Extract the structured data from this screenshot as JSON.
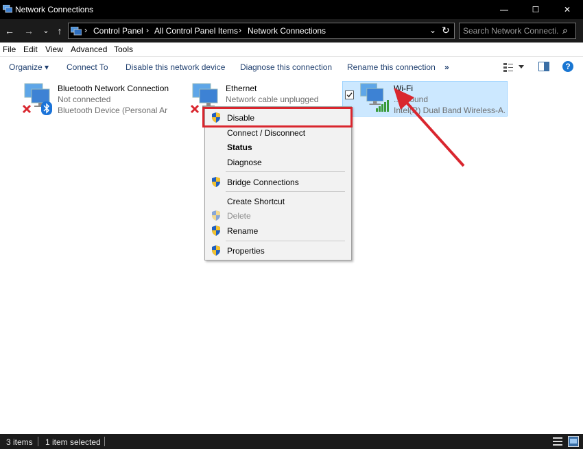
{
  "window": {
    "title": "Network Connections",
    "minimize_glyph": "—",
    "maximize_glyph": "☐",
    "close_glyph": "✕"
  },
  "address": {
    "back_glyph": "←",
    "forward_glyph": "→",
    "recent_glyph": "⌄",
    "up_glyph": "↑",
    "breadcrumb": [
      "Control Panel",
      "All Control Panel Items",
      "Network Connections"
    ],
    "separator": "›",
    "dropdown_glyph": "⌄",
    "refresh_glyph": "↻",
    "search_placeholder": "Search Network Connecti...",
    "search_glyph": "⌕"
  },
  "menu": [
    "File",
    "Edit",
    "View",
    "Advanced",
    "Tools"
  ],
  "commands": {
    "organize": "Organize ▾",
    "connect_to": "Connect To",
    "disable_device": "Disable this network device",
    "diagnose": "Diagnose this connection",
    "rename": "Rename this connection",
    "more": "»",
    "help": "?"
  },
  "connections": [
    {
      "name": "Bluetooth Network Connection",
      "status": "Not connected",
      "device": "Bluetooth Device (Personal Ar..."
    },
    {
      "name": "Ethernet",
      "status": "Network cable unplugged",
      "device": ""
    },
    {
      "name": "Wi-Fi",
      "status": "...Ground",
      "device": "Intel(R) Dual Band Wireless-A..."
    }
  ],
  "context_menu": [
    {
      "label": "Disable",
      "shield": true,
      "style": "normal"
    },
    {
      "label": "Connect / Disconnect",
      "shield": false,
      "style": "normal"
    },
    {
      "label": "Status",
      "shield": false,
      "style": "bold"
    },
    {
      "label": "Diagnose",
      "shield": false,
      "style": "normal"
    },
    {
      "label": "Bridge Connections",
      "shield": true,
      "style": "normal"
    },
    {
      "label": "Create Shortcut",
      "shield": false,
      "style": "normal"
    },
    {
      "label": "Delete",
      "shield": true,
      "style": "disabled"
    },
    {
      "label": "Rename",
      "shield": true,
      "style": "normal"
    },
    {
      "label": "Properties",
      "shield": true,
      "style": "normal"
    }
  ],
  "status_bar": {
    "items_count": "3 items",
    "selected": "1 item selected"
  },
  "colors": {
    "annotation_red": "#d9262e",
    "selection_bg": "#cce8ff",
    "link_blue": "#1f3f6f"
  }
}
